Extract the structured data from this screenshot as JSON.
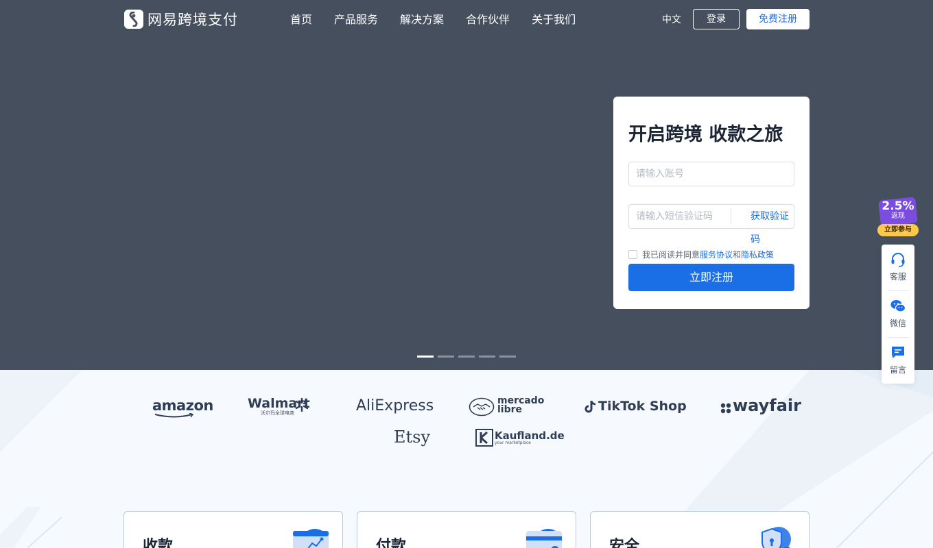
{
  "brand": {
    "name": "网易跨境支付"
  },
  "nav": [
    {
      "label": "首页"
    },
    {
      "label": "产品服务"
    },
    {
      "label": "解决方案"
    },
    {
      "label": "合作伙伴"
    },
    {
      "label": "关于我们"
    }
  ],
  "header": {
    "language": "中文",
    "login": "登录",
    "register": "免费注册"
  },
  "register_card": {
    "title": "开启跨境 收款之旅",
    "account_placeholder": "请输入账号",
    "code_placeholder": "请输入短信验证码",
    "get_code": "获取验证码",
    "agree_prefix": "我已阅读并同意",
    "agree_link1": "服务协议",
    "agree_sep": "和",
    "agree_link2": "隐私政策",
    "submit": "立即注册"
  },
  "carousel": {
    "slides": 5,
    "active_index": 0
  },
  "partners": [
    {
      "name": "amazon"
    },
    {
      "name": "Walmart",
      "sub": "沃尔玛全球电商"
    },
    {
      "name": "AliExpress"
    },
    {
      "name": "mercado",
      "name2": "libre"
    },
    {
      "name": "TikTok Shop"
    },
    {
      "name": "wayfair"
    },
    {
      "name": "Etsy"
    },
    {
      "name": "Kaufland.de",
      "sub": "your marketplace"
    }
  ],
  "features": [
    {
      "title": "收款"
    },
    {
      "title": "付款"
    },
    {
      "title": "安全"
    }
  ],
  "promo": {
    "percent": "2.5%",
    "subtitle": "返现",
    "cta": "立即参与"
  },
  "sidebar": [
    {
      "label": "客服",
      "icon": "headset-icon"
    },
    {
      "label": "微信",
      "icon": "wechat-icon"
    },
    {
      "label": "留言",
      "icon": "message-icon"
    }
  ],
  "colors": {
    "hero_bg": "#454f5e",
    "primary": "#1a6ee6",
    "promo": "#7a4dde",
    "promo_cta": "#ffc94a"
  }
}
